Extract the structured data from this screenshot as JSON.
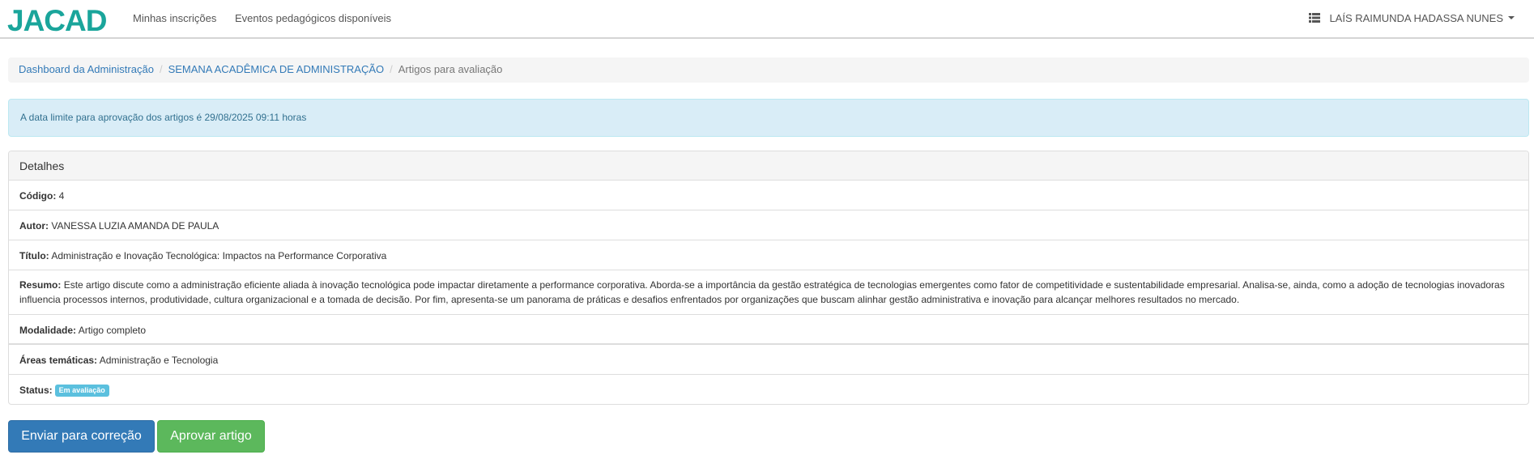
{
  "navbar": {
    "logo_text": "JACAD",
    "links": [
      "Minhas inscrições",
      "Eventos pedagógicos disponíveis"
    ],
    "user_name": "LAÍS RAIMUNDA HADASSA NUNES",
    "brand_color": "#1aa59b"
  },
  "breadcrumb": {
    "items": [
      "Dashboard da Administração",
      "SEMANA ACADÊMICA DE ADMINISTRAÇÃO"
    ],
    "active": "Artigos para avaliação"
  },
  "alert": {
    "text": "A data limite para aprovação dos artigos é 29/08/2025 09:11 horas"
  },
  "details": {
    "title": "Detalhes",
    "codigo_label": "Código:",
    "codigo": "4",
    "autor_label": "Autor:",
    "autor": "VANESSA LUZIA AMANDA DE PAULA",
    "titulo_label": "Título:",
    "titulo": "Administração e Inovação Tecnológica: Impactos na Performance Corporativa",
    "resumo_label": "Resumo:",
    "resumo": "Este artigo discute como a administração eficiente aliada à inovação tecnológica pode impactar diretamente a performance corporativa. Aborda-se a importância da gestão estratégica de tecnologias emergentes como fator de competitividade e sustentabilidade empresarial. Analisa-se, ainda, como a adoção de tecnologias inovadoras influencia processos internos, produtividade, cultura organizacional e a tomada de decisão. Por fim, apresenta-se um panorama de práticas e desafios enfrentados por organizações que buscam alinhar gestão administrativa e inovação para alcançar melhores resultados no mercado.",
    "modalidade_label": "Modalidade:",
    "modalidade": "Artigo completo",
    "areas_label": "Áreas temáticas:",
    "areas": "Administração e Tecnologia",
    "status_label": "Status:",
    "status": "Em avaliação"
  },
  "actions": {
    "send_correction": "Enviar para correção",
    "approve": "Aprovar artigo"
  }
}
